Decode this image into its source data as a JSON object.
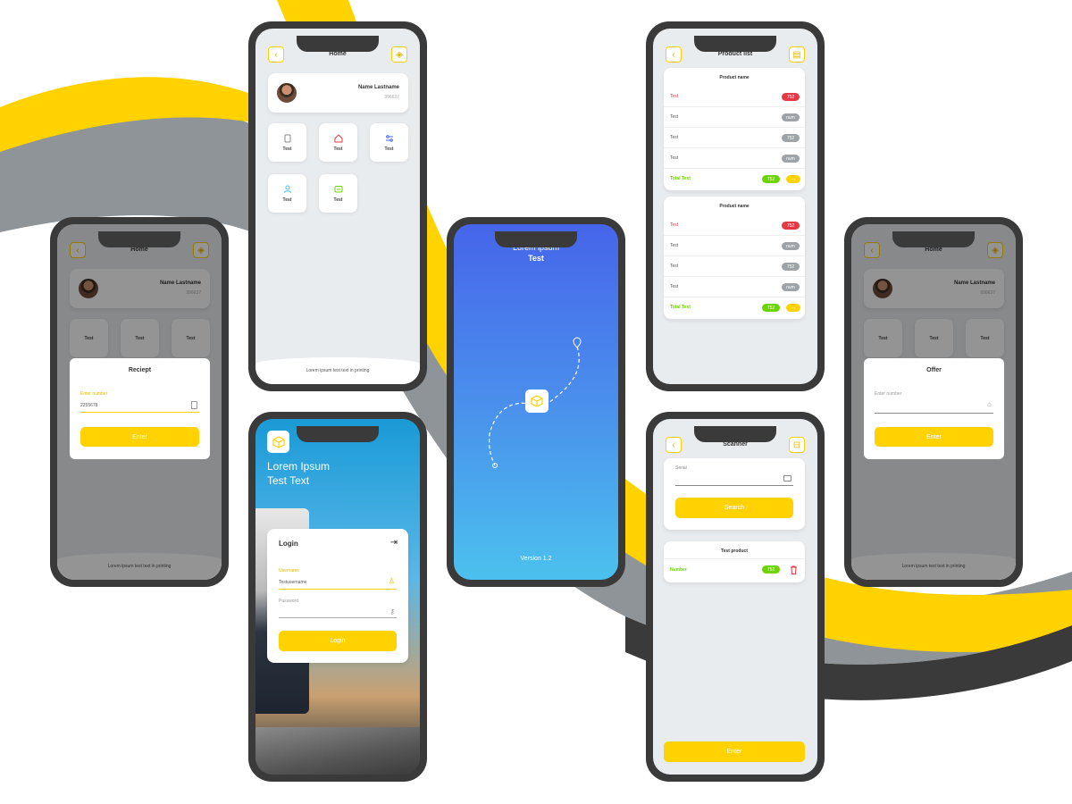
{
  "colors": {
    "yellow": "#FFD200",
    "dark": "#3A3A3A",
    "gray": "#9EA3A7",
    "blue_top": "#4665EA",
    "blue_bottom": "#4BC1EE",
    "red": "#E53945",
    "green": "#6DD400"
  },
  "home": {
    "title": "Home",
    "name": "Name Lastname",
    "id": "996637",
    "tiles": [
      {
        "label": "Test",
        "icon": "document-icon"
      },
      {
        "label": "Test",
        "icon": "home-icon"
      },
      {
        "label": "Test",
        "icon": "sliders-icon"
      },
      {
        "label": "Test",
        "icon": "user-icon"
      },
      {
        "label": "Test",
        "icon": "message-icon"
      }
    ],
    "footer": "Lorem ipsum test text in printing"
  },
  "receipt": {
    "title": "Home",
    "name": "Name Lastname",
    "id": "996637",
    "tiles": [
      "Test",
      "Test",
      "Test"
    ],
    "modal_title": "Reciept",
    "field_label": "Enter number",
    "field_value": "2255678",
    "button": "Enter",
    "footer": "Lorem ipsum test text in printing"
  },
  "offer": {
    "title": "Home",
    "name": "Name Lastname",
    "id": "996637",
    "tiles": [
      "Test",
      "Test",
      "Test"
    ],
    "modal_title": "Offer",
    "field_placeholder": "Enter number",
    "button": "Enter",
    "footer": "Lorem ipsum test text in printing"
  },
  "login": {
    "headline1": "Lorem Ipsum",
    "headline2": "Test Text",
    "card_title": "Login",
    "username_label": "Username",
    "username_value": "Testusername",
    "password_placeholder": "Password",
    "button": "Login"
  },
  "splash": {
    "title1": "Lorem ipsum",
    "title2": "Test",
    "version": "Version 1.2"
  },
  "products": {
    "title": "Product list",
    "lists": [
      {
        "header": "Product name",
        "rows": [
          {
            "name": "Test",
            "badge": "752",
            "color": "red"
          },
          {
            "name": "Test",
            "badge": "num",
            "color": "gray"
          },
          {
            "name": "Test",
            "badge": "752",
            "color": "gray"
          },
          {
            "name": "Test",
            "badge": "num",
            "color": "gray"
          }
        ],
        "total_label": "Total Text",
        "total_badge": "752"
      },
      {
        "header": "Product name",
        "rows": [
          {
            "name": "Test",
            "badge": "752",
            "color": "red"
          },
          {
            "name": "Test",
            "badge": "num",
            "color": "gray"
          },
          {
            "name": "Test",
            "badge": "752",
            "color": "gray"
          },
          {
            "name": "Test",
            "badge": "num",
            "color": "gray"
          }
        ],
        "total_label": "Total Text",
        "total_badge": "752"
      }
    ]
  },
  "scanner": {
    "title": "Scanner",
    "serial_label": "Serial",
    "search_button": "Search",
    "product_header": "Test product",
    "number_label": "Number",
    "number_badge": "752",
    "enter_button": "Enter"
  }
}
